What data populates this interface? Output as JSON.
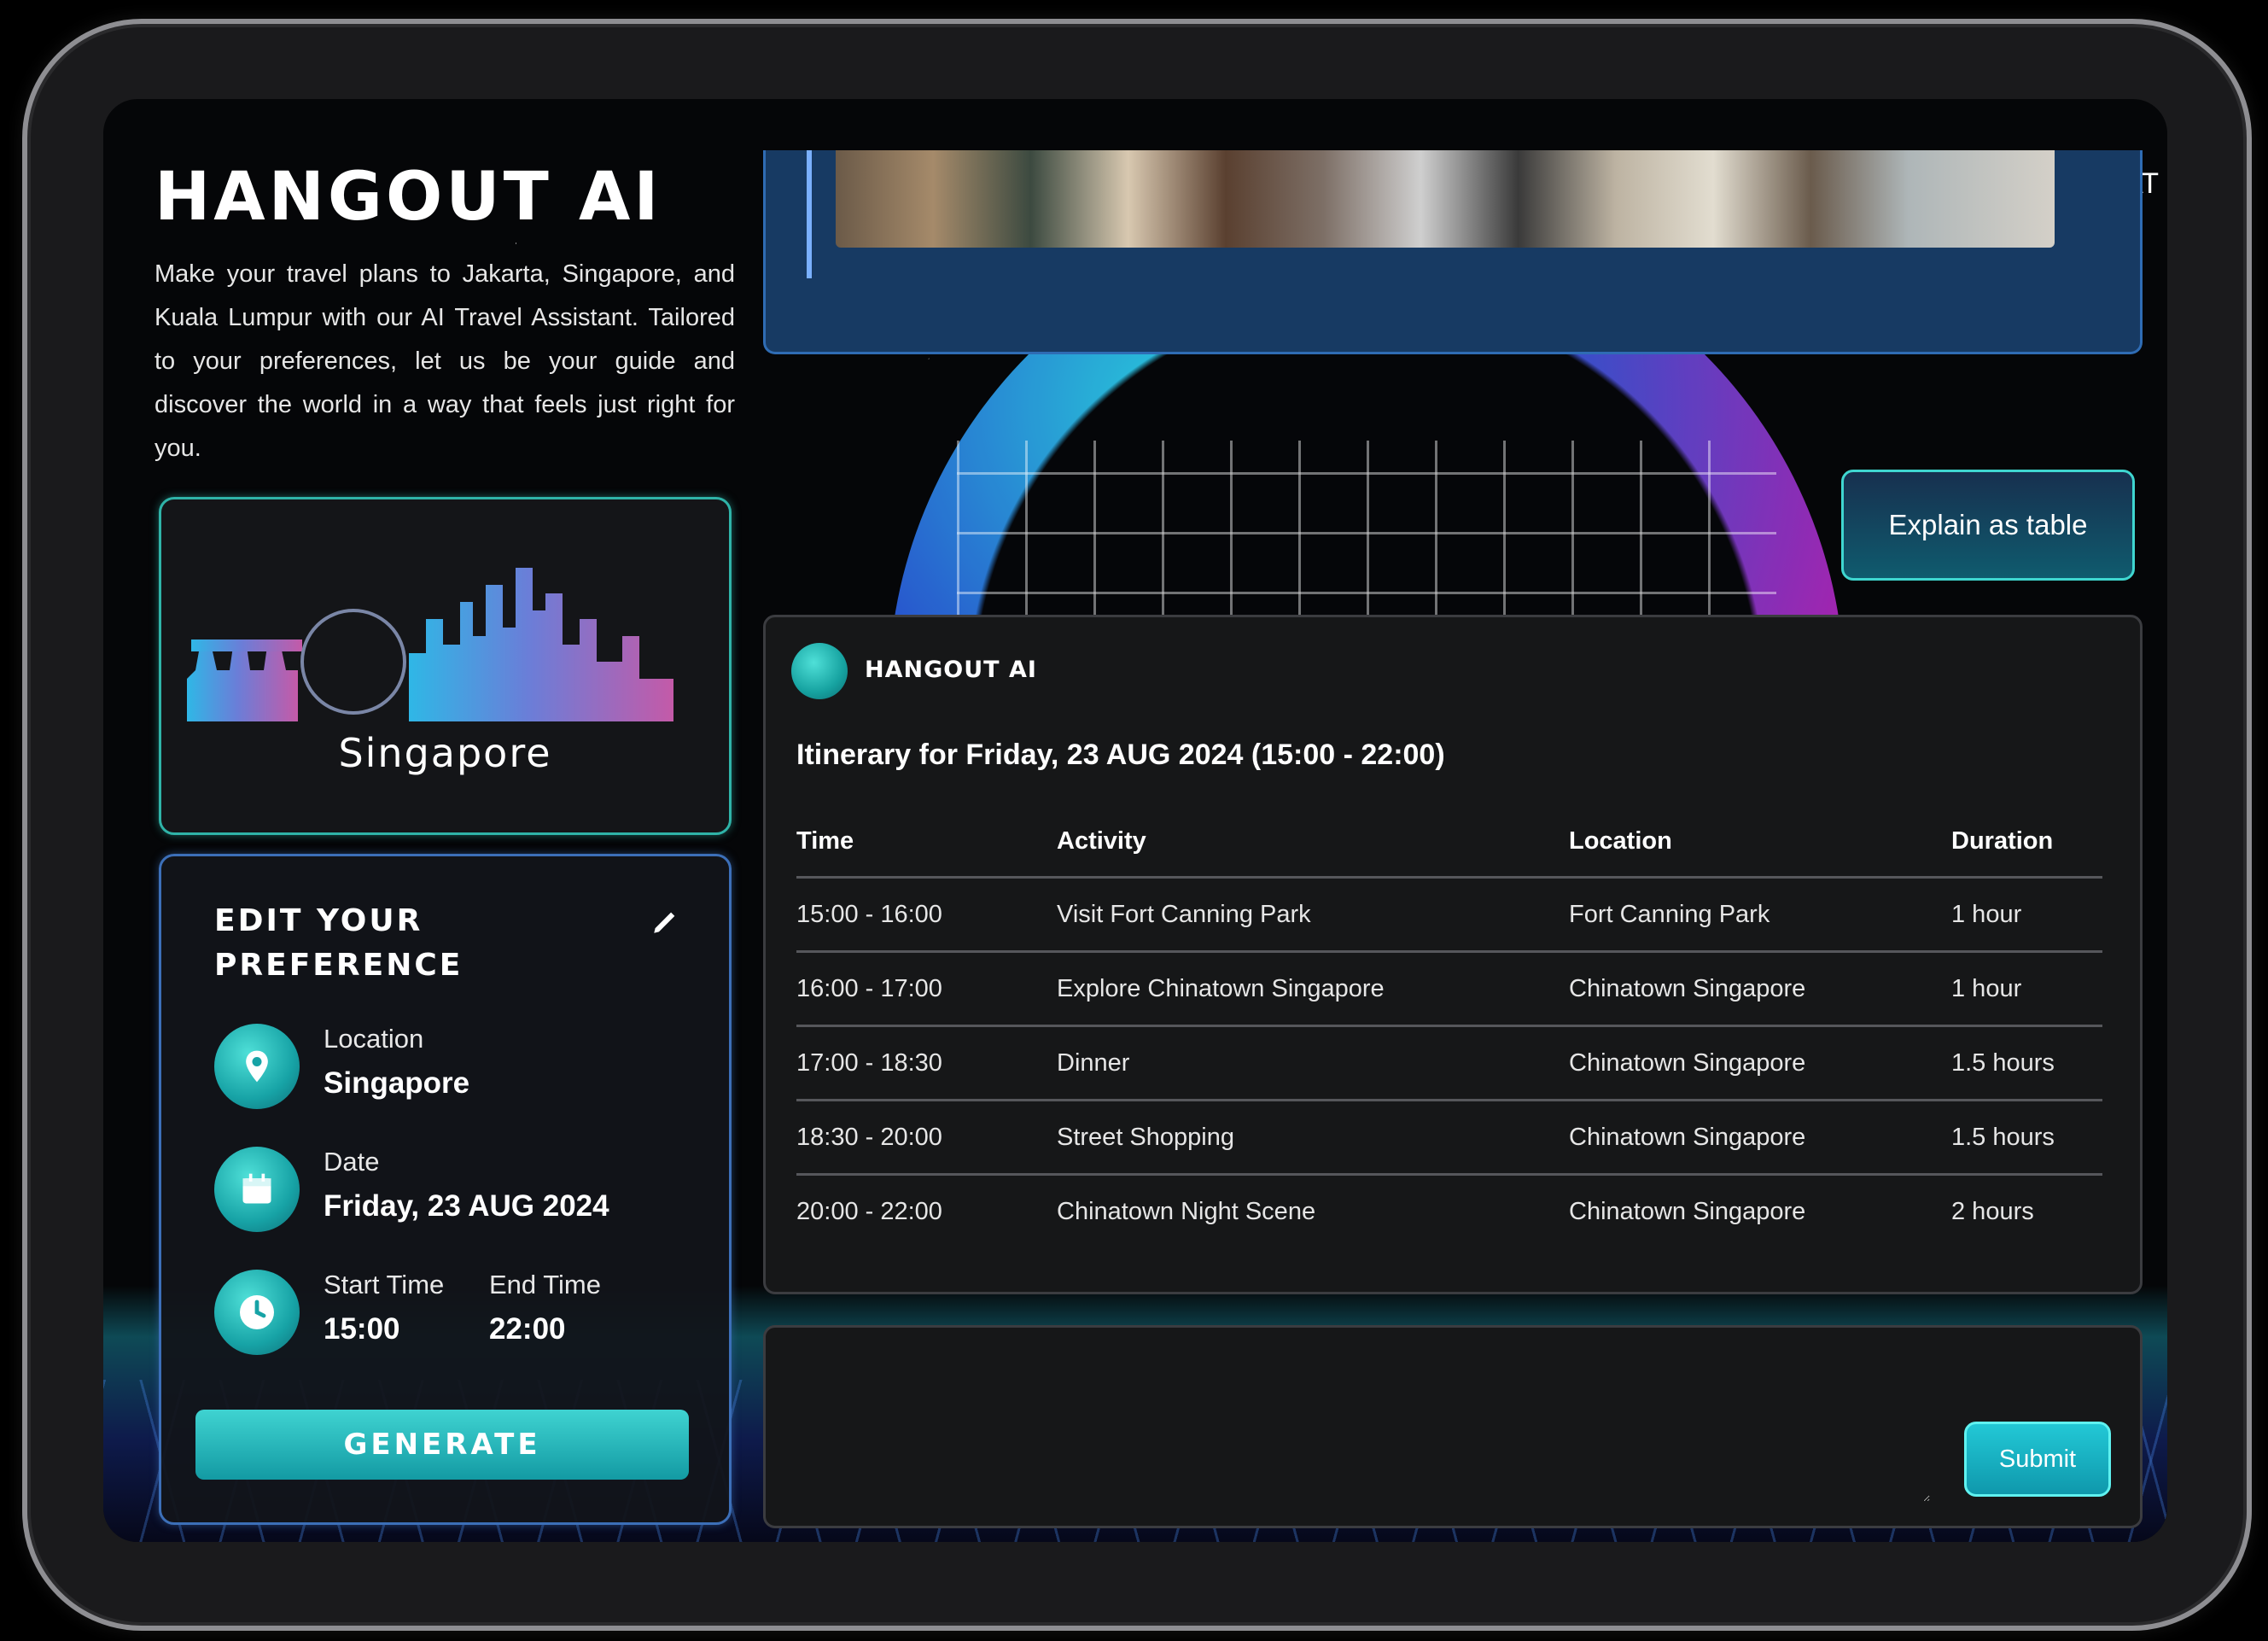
{
  "brand": "HANGOUT AI",
  "nav": {
    "chat": "CHAT"
  },
  "intro": "Make your travel plans to Jakarta, Singapore, and Kuala Lumpur with our AI Travel Assistant. Tailored to your preferences, let us be your guide and discover the world in a way that feels just right for you.",
  "city_card": {
    "name": "Singapore"
  },
  "preference": {
    "title": "EDIT YOUR PREFERENCE",
    "location_label": "Location",
    "location_value": "Singapore",
    "date_label": "Date",
    "date_value": "Friday, 23 AUG 2024",
    "start_label": "Start Time",
    "start_value": "15:00",
    "end_label": "End Time",
    "end_value": "22:00",
    "generate": "GENERATE"
  },
  "explain_button": "Explain as table",
  "chat": {
    "bot_name": "HANGOUT AI",
    "itinerary_title": "Itinerary for Friday, 23 AUG 2024 (15:00 - 22:00)",
    "columns": [
      "Time",
      "Activity",
      "Location",
      "Duration"
    ],
    "rows": [
      [
        "15:00 - 16:00",
        "Visit Fort Canning Park",
        "Fort Canning Park",
        "1 hour"
      ],
      [
        "16:00 - 17:00",
        "Explore Chinatown Singapore",
        "Chinatown Singapore",
        "1 hour"
      ],
      [
        "17:00 - 18:30",
        "Dinner",
        "Chinatown Singapore",
        "1.5 hours"
      ],
      [
        "18:30 - 20:00",
        "Street Shopping",
        "Chinatown Singapore",
        "1.5 hours"
      ],
      [
        "20:00 - 22:00",
        "Chinatown Night Scene",
        "Chinatown Singapore",
        "2 hours"
      ]
    ]
  },
  "input": {
    "value": "",
    "submit": "Submit"
  },
  "colors": {
    "accent": "#1fb3b5",
    "panel_blue": "#173a63",
    "panel_dark": "#161718"
  },
  "icons": [
    "map-pin-icon",
    "calendar-icon",
    "clock-icon",
    "pencil-icon"
  ]
}
